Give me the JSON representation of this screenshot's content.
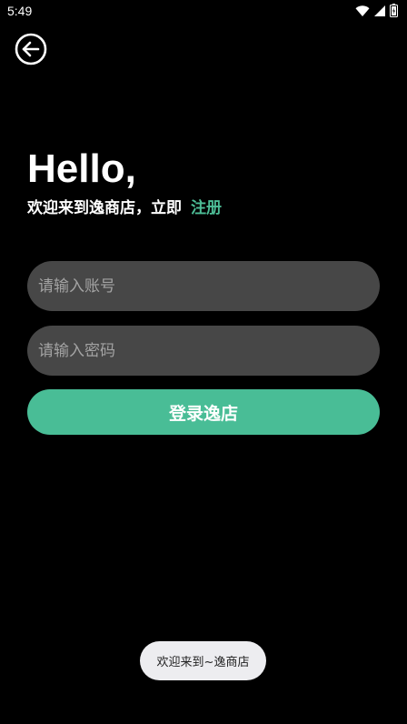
{
  "status_bar": {
    "time": "5:49",
    "icons": [
      "wifi-icon",
      "cellular-signal-icon",
      "battery-icon"
    ]
  },
  "header": {
    "back_icon": "back-arrow-circle-icon"
  },
  "greeting": {
    "hello": "Hello,",
    "welcome_text": "欢迎来到逸商店，立即",
    "register_link": "注册"
  },
  "form": {
    "account_placeholder": "请输入账号",
    "account_value": "",
    "password_placeholder": "请输入密码",
    "password_value": "",
    "login_button": "登录逸店"
  },
  "toast": {
    "message": "欢迎来到~逸商店"
  },
  "colors": {
    "background": "#000000",
    "accent": "#49bd96",
    "input_background": "#474747",
    "toast_background": "#ededf0"
  }
}
